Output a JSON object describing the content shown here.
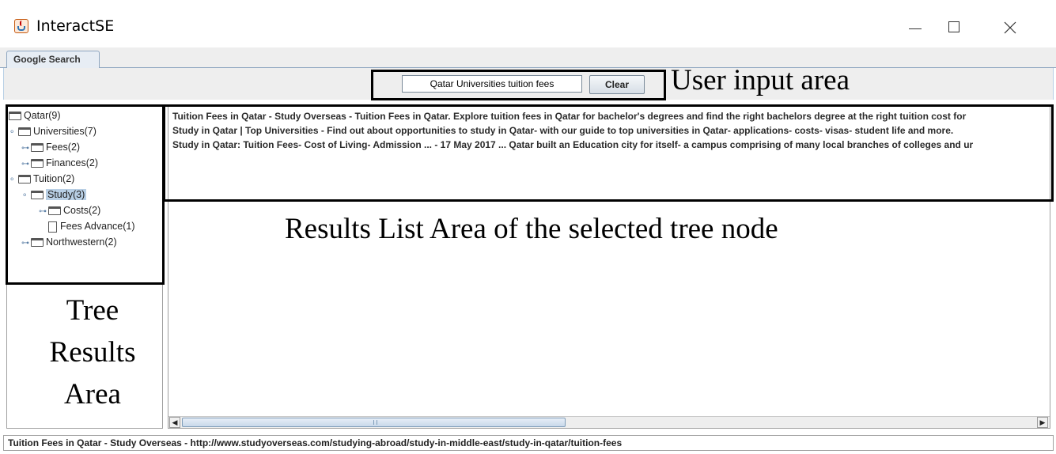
{
  "window": {
    "title": "InteractSE",
    "app_icon": "java-cup-icon",
    "controls": {
      "minimize_icon": "minimize-icon",
      "maximize_icon": "maximize-icon",
      "close_icon": "close-icon"
    }
  },
  "tabs": [
    {
      "label": "Google Search",
      "selected": true
    }
  ],
  "search": {
    "value": "Qatar Universities tuition fees",
    "clear_label": "Clear"
  },
  "tree": {
    "nodes": [
      {
        "label": "Qatar(9)"
      },
      {
        "label": "Universities(7)"
      },
      {
        "label": "Fees(2)"
      },
      {
        "label": "Finances(2)"
      },
      {
        "label": "Tuition(2)"
      },
      {
        "label": "Study(3)",
        "selected": true
      },
      {
        "label": "Costs(2)"
      },
      {
        "label": "Fees Advance(1)"
      },
      {
        "label": "Northwestern(2)"
      }
    ]
  },
  "results": [
    "Tuition Fees in Qatar - Study Overseas - Tuition Fees in Qatar. Explore tuition fees in Qatar for bachelor's degrees and find the right bachelors degree at the right tuition cost for",
    "Study in Qatar | Top Universities - Find out about opportunities to study in Qatar- with our guide to top universities in Qatar- applications- costs- visas- student life and more.",
    "Study in Qatar: Tuition Fees- Cost of Living- Admission ... - 17 May 2017 ... Qatar built an Education city for itself- a campus comprising of many local branches of colleges and ur"
  ],
  "status_text": "Tuition Fees in Qatar - Study Overseas - http://www.studyoverseas.com/studying-abroad/study-in-middle-east/study-in-qatar/tuition-fees",
  "annotations": {
    "input_area": "User input area",
    "results_area": "Results List Area of the selected tree node",
    "tree_area_lines": [
      "Tree",
      "Results",
      "Area"
    ]
  },
  "colors": {
    "selection": "#b8cfe5",
    "tab_border": "#8ea6c0",
    "annotation_box": "#000000"
  }
}
